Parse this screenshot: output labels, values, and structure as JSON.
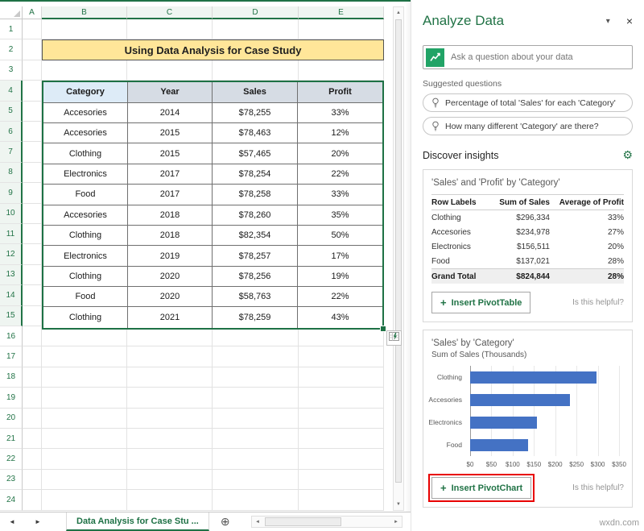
{
  "app": {
    "watermark": "wxdn.com"
  },
  "colors": {
    "excel_green": "#217346",
    "title_fill": "#FFE699",
    "header_blue": "#DDEBF7",
    "header_gray": "#D6DCE4",
    "bar_blue": "#4472C4",
    "highlight_red": "#E80000"
  },
  "icons": {
    "caret_down": "▾",
    "close": "×",
    "gear": "⚙",
    "scroll_up": "▲",
    "scroll_down": "▼",
    "scroll_left": "◄",
    "scroll_right": "►",
    "nav_left": "◄",
    "nav_right": "►",
    "new_sheet": "⊕",
    "plus": "+"
  },
  "spreadsheet": {
    "column_headers": [
      "A",
      "B",
      "C",
      "D",
      "E"
    ],
    "row_numbers": [
      1,
      2,
      3,
      4,
      5,
      6,
      7,
      8,
      9,
      10,
      11,
      12,
      13,
      14,
      15,
      16,
      17,
      18,
      19,
      20,
      21,
      22,
      23,
      24
    ],
    "title": "Using Data Analysis for Case Study",
    "table": {
      "headers": [
        "Category",
        "Year",
        "Sales",
        "Profit"
      ],
      "rows": [
        [
          "Accesories",
          "2014",
          "$78,255",
          "33%"
        ],
        [
          "Accesories",
          "2015",
          "$78,463",
          "12%"
        ],
        [
          "Clothing",
          "2015",
          "$57,465",
          "20%"
        ],
        [
          "Electronics",
          "2017",
          "$78,254",
          "22%"
        ],
        [
          "Food",
          "2017",
          "$78,258",
          "33%"
        ],
        [
          "Accesories",
          "2018",
          "$78,260",
          "35%"
        ],
        [
          "Clothing",
          "2018",
          "$82,354",
          "50%"
        ],
        [
          "Electronics",
          "2019",
          "$78,257",
          "17%"
        ],
        [
          "Clothing",
          "2020",
          "$78,256",
          "19%"
        ],
        [
          "Food",
          "2020",
          "$58,763",
          "22%"
        ],
        [
          "Clothing",
          "2021",
          "$78,259",
          "43%"
        ]
      ]
    },
    "sheet_tab": "Data Analysis for Case Stu ..."
  },
  "pane": {
    "title": "Analyze Data",
    "search_placeholder": "Ask a question about your data",
    "suggested_label": "Suggested questions",
    "suggestions": [
      "Percentage of total 'Sales' for each 'Category'",
      "How many different 'Category' are there?"
    ],
    "discover_label": "Discover insights",
    "pivot_card": {
      "title": "'Sales' and 'Profit' by 'Category'",
      "headers": [
        "Row Labels",
        "Sum of Sales",
        "Average of Profit"
      ],
      "rows": [
        [
          "Clothing",
          "$296,334",
          "33%"
        ],
        [
          "Accesories",
          "$234,978",
          "27%"
        ],
        [
          "Electronics",
          "$156,511",
          "20%"
        ],
        [
          "Food",
          "$137,021",
          "28%"
        ]
      ],
      "total_row": [
        "Grand Total",
        "$824,844",
        "28%"
      ],
      "insert_label": "Insert PivotTable",
      "helpful": "Is this helpful?"
    },
    "chart_card": {
      "title": "'Sales' by 'Category'",
      "subtitle": "Sum of Sales (Thousands)",
      "insert_label": "Insert PivotChart",
      "helpful": "Is this helpful?"
    }
  },
  "chart_data": {
    "type": "bar",
    "orientation": "horizontal",
    "title": "'Sales' by 'Category'",
    "subtitle": "Sum of Sales (Thousands)",
    "categories": [
      "Clothing",
      "Accesories",
      "Electronics",
      "Food"
    ],
    "values": [
      296.334,
      234.978,
      156.511,
      137.021
    ],
    "unit": "thousands of dollars",
    "xlim": [
      0,
      350
    ],
    "xticks": [
      "$0",
      "$50",
      "$100",
      "$150",
      "$200",
      "$250",
      "$300",
      "$350"
    ],
    "grid": true,
    "legend": false,
    "bar_color": "#4472C4"
  }
}
